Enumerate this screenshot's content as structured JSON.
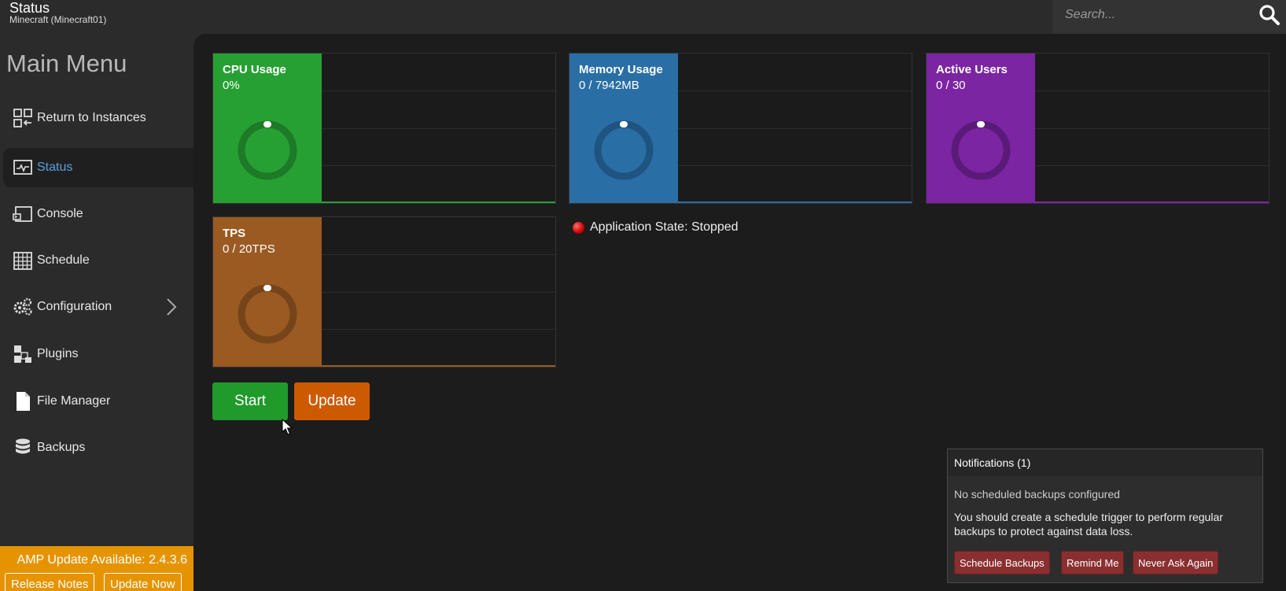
{
  "header": {
    "title": "Status",
    "subtitle": "Minecraft (Minecraft01)"
  },
  "search": {
    "placeholder": "Search...",
    "icon": "search-icon"
  },
  "sidebar": {
    "title": "Main Menu",
    "items": [
      {
        "label": "Return to Instances",
        "icon": "instances-icon"
      },
      {
        "label": "Status",
        "icon": "status-icon",
        "active": true
      },
      {
        "label": "Console",
        "icon": "console-icon"
      },
      {
        "label": "Schedule",
        "icon": "schedule-icon"
      },
      {
        "label": "Configuration",
        "icon": "gears-icon",
        "has_submenu": true
      },
      {
        "label": "Plugins",
        "icon": "plugins-icon"
      },
      {
        "label": "File Manager",
        "icon": "file-icon"
      },
      {
        "label": "Backups",
        "icon": "database-icon"
      }
    ],
    "update_banner": {
      "text": "AMP Update Available: 2.4.3.6",
      "release_notes": "Release Notes",
      "update_now": "Update Now",
      "color": "#e59400"
    }
  },
  "metrics": [
    {
      "name": "CPU Usage",
      "value": "0%",
      "color": "#27a033",
      "ring": "#1d7a27"
    },
    {
      "name": "Memory Usage",
      "value": "0 / 7942MB",
      "color": "#2a6ea6",
      "ring": "#1f5380"
    },
    {
      "name": "Active Users",
      "value": "0 / 30",
      "color": "#7b25a3",
      "ring": "#5a1b78"
    },
    {
      "name": "TPS",
      "value": "0 / 20TPS",
      "color": "#9a5a22",
      "ring": "#75441a"
    }
  ],
  "app_state": {
    "text": "Application State: Stopped",
    "color": "#d00000"
  },
  "actions": {
    "start": "Start",
    "start_color": "#1f9a2b",
    "update": "Update",
    "update_color": "#cc5a00"
  },
  "notification": {
    "header": "Notifications (1)",
    "title": "No scheduled backups configured",
    "body": "You should create a schedule trigger to perform regular backups to protect against data loss.",
    "buttons": {
      "schedule": "Schedule Backups",
      "remind": "Remind Me",
      "never": "Never Ask Again"
    }
  }
}
